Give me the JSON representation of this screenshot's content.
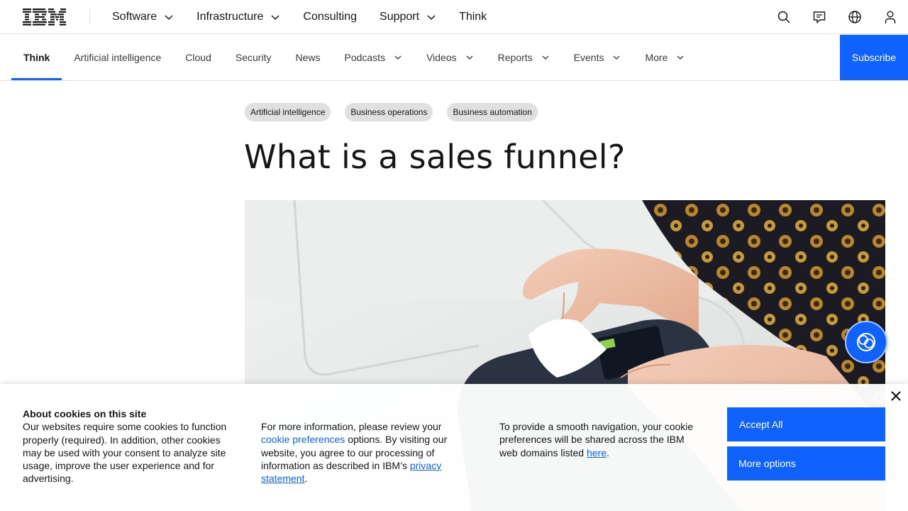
{
  "masthead": {
    "logo_text": "IBM",
    "nav": [
      {
        "label": "Software",
        "has_dropdown": true
      },
      {
        "label": "Infrastructure",
        "has_dropdown": true
      },
      {
        "label": "Consulting",
        "has_dropdown": false
      },
      {
        "label": "Support",
        "has_dropdown": true
      },
      {
        "label": "Think",
        "has_dropdown": false
      }
    ],
    "icons": [
      "search-icon",
      "chat-icon",
      "globe-icon",
      "user-icon"
    ]
  },
  "subnav": {
    "items": [
      {
        "label": "Think",
        "active": true
      },
      {
        "label": "Artificial intelligence"
      },
      {
        "label": "Cloud"
      },
      {
        "label": "Security"
      },
      {
        "label": "News"
      },
      {
        "label": "Podcasts",
        "has_dropdown": true
      },
      {
        "label": "Videos",
        "has_dropdown": true
      },
      {
        "label": "Reports",
        "has_dropdown": true
      },
      {
        "label": "Events",
        "has_dropdown": true
      },
      {
        "label": "More",
        "has_dropdown": true
      }
    ],
    "subscribe_label": "Subscribe"
  },
  "article": {
    "tags": [
      "Artificial intelligence",
      "Business operations",
      "Business automation"
    ],
    "title": "What is a sales funnel?"
  },
  "cookie": {
    "heading": "About cookies on this site",
    "col1_text": "Our websites require some cookies to function properly (required). In addition, other cookies may be used with your consent to analyze site usage, improve the user experience and for advertising.",
    "col2_pre": "For more information, please review your",
    "col2_link1": "cookie preferences",
    "col2_mid": " options. By visiting our website, you agree to our processing of information as described in IBM’s",
    "col2_link2": "privacy statement",
    "col2_post": ".",
    "col3_pre": "To provide a smooth navigation, your cookie preferences will be shared across the IBM web domains listed ",
    "col3_link": "here",
    "col3_post": ".",
    "accept_label": "Accept All",
    "more_label": "More options"
  },
  "colors": {
    "accent": "#0f62fe",
    "tag_bg": "#e0e0e0",
    "text": "#161616"
  }
}
